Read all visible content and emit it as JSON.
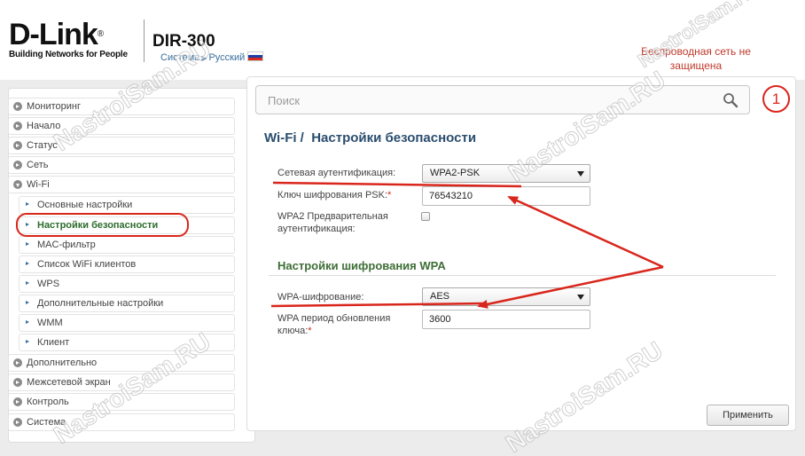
{
  "header": {
    "logo_text": "D-Link",
    "logo_registered": "®",
    "logo_tagline": "Building Networks for People",
    "model": "DIR-300",
    "nav_system": "Система",
    "nav_language": "Русский",
    "notification": "Беспроводная сеть не защищена"
  },
  "search": {
    "placeholder": "Поиск"
  },
  "badge": {
    "count": "1"
  },
  "sidebar": {
    "items": [
      {
        "label": "Мониторинг"
      },
      {
        "label": "Начало"
      },
      {
        "label": "Статус"
      },
      {
        "label": "Сеть"
      },
      {
        "label": "Wi-Fi"
      },
      {
        "label": "Основные настройки"
      },
      {
        "label": "Настройки безопасности"
      },
      {
        "label": "MAC-фильтр"
      },
      {
        "label": "Список WiFi клиентов"
      },
      {
        "label": "WPS"
      },
      {
        "label": "Дополнительные настройки"
      },
      {
        "label": "WMM"
      },
      {
        "label": "Клиент"
      },
      {
        "label": "Дополнительно"
      },
      {
        "label": "Межсетевой экран"
      },
      {
        "label": "Контроль"
      },
      {
        "label": "Система"
      }
    ]
  },
  "page": {
    "breadcrumb_section": "Wi-Fi /",
    "title": "Настройки безопасности",
    "auth_label": "Сетевая аутентификация:",
    "auth_value": "WPA2-PSK",
    "psk_label": "Ключ шифрования PSK:",
    "psk_value": "76543210",
    "preauth_label": "WPA2 Предварительная аутентификация:",
    "wpa_section": "Настройки шифрования WPA",
    "encryption_label": "WPA-шифрование:",
    "encryption_value": "AES",
    "renewal_label": "WPA период обновления ключа:",
    "renewal_value": "3600",
    "required_mark": "*",
    "apply_label": "Применить"
  },
  "watermark": {
    "text": "NastroiSam.RU"
  },
  "colors": {
    "accent_red": "#d9261c",
    "title_blue": "#2a4d6e",
    "section_green": "#3d6e35",
    "active_green": "#2c6d2c",
    "link_blue": "#3a6e9c"
  }
}
